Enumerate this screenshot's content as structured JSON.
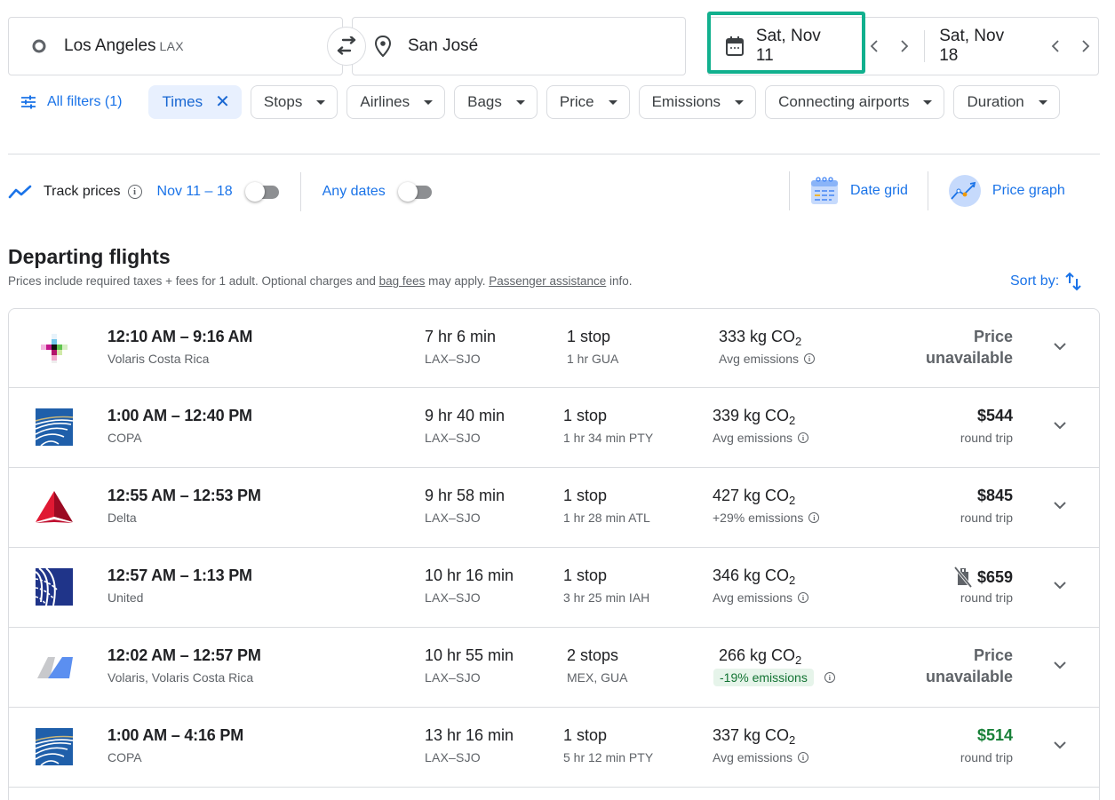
{
  "search": {
    "origin": {
      "city": "Los Angeles",
      "code": "LAX"
    },
    "destination": {
      "city": "San José"
    },
    "depart_date": "Sat, Nov 11",
    "return_date": "Sat, Nov 18"
  },
  "filters": {
    "all_filters": "All filters (1)",
    "active_chip": "Times",
    "chips": [
      "Stops",
      "Airlines",
      "Bags",
      "Price",
      "Emissions",
      "Connecting airports",
      "Duration"
    ]
  },
  "tracking": {
    "track_label": "Track prices",
    "track_dates": "Nov 11 – 18",
    "track_enabled": false,
    "any_dates": "Any dates",
    "any_dates_enabled": false,
    "date_grid": "Date grid",
    "price_graph": "Price graph"
  },
  "section": {
    "title": "Departing flights",
    "note_pre": "Prices include required taxes + fees for 1 adult. Optional charges and ",
    "bag_fees_link": "bag fees",
    "note_mid": " may apply. ",
    "assist_link": "Passenger assistance",
    "note_post": " info.",
    "sort_label": "Sort by:"
  },
  "colors": {
    "accent": "#1a73e8",
    "highlight": "#11b08e",
    "good_price": "#188038",
    "low_emission_bg": "#e6f4ea"
  },
  "flights": [
    {
      "logo": "volaris-costa-rica-logo",
      "times": "12:10 AM – 9:16 AM",
      "airline": "Volaris Costa Rica",
      "duration": "7 hr 6 min",
      "route": "LAX–SJO",
      "stops": "1 stop",
      "stop_detail": "1 hr GUA",
      "co2_value": "333 kg CO",
      "co2_sub": "2",
      "emissions_note": "Avg emissions",
      "price_unavailable": [
        "Price",
        "unavailable"
      ]
    },
    {
      "logo": "copa-logo",
      "times": "1:00 AM – 12:40 PM",
      "airline": "COPA",
      "duration": "9 hr 40 min",
      "route": "LAX–SJO",
      "stops": "1 stop",
      "stop_detail": "1 hr 34 min PTY",
      "co2_value": "339 kg CO",
      "co2_sub": "2",
      "emissions_note": "Avg emissions",
      "price": "$544",
      "price_type": "round trip"
    },
    {
      "logo": "delta-logo",
      "times": "12:55 AM – 12:53 PM",
      "airline": "Delta",
      "duration": "9 hr 58 min",
      "route": "LAX–SJO",
      "stops": "1 stop",
      "stop_detail": "1 hr 28 min ATL",
      "co2_value": "427 kg CO",
      "co2_sub": "2",
      "emissions_note": "+29% emissions",
      "price": "$845",
      "price_type": "round trip"
    },
    {
      "logo": "united-logo",
      "times": "12:57 AM – 1:13 PM",
      "airline": "United",
      "duration": "10 hr 16 min",
      "route": "LAX–SJO",
      "stops": "1 stop",
      "stop_detail": "3 hr 25 min IAH",
      "co2_value": "346 kg CO",
      "co2_sub": "2",
      "emissions_note": "Avg emissions",
      "price": "$659",
      "price_type": "round trip",
      "no_carry_on": true
    },
    {
      "logo": "volaris-logo",
      "times": "12:02 AM – 12:57 PM",
      "airline": "Volaris, Volaris Costa Rica",
      "duration": "10 hr 55 min",
      "route": "LAX–SJO",
      "stops": "2 stops",
      "stop_detail": "MEX, GUA",
      "co2_value": "266 kg CO",
      "co2_sub": "2",
      "emissions_note": "-19% emissions",
      "price_unavailable": [
        "Price",
        "unavailable"
      ]
    },
    {
      "logo": "copa-logo",
      "times": "1:00 AM – 4:16 PM",
      "airline": "COPA",
      "duration": "13 hr 16 min",
      "route": "LAX–SJO",
      "stops": "1 stop",
      "stop_detail": "5 hr 12 min PTY",
      "co2_value": "337 kg CO",
      "co2_sub": "2",
      "emissions_note": "Avg emissions",
      "price": "$514",
      "price_type": "round trip",
      "price_highlight": "good"
    }
  ]
}
